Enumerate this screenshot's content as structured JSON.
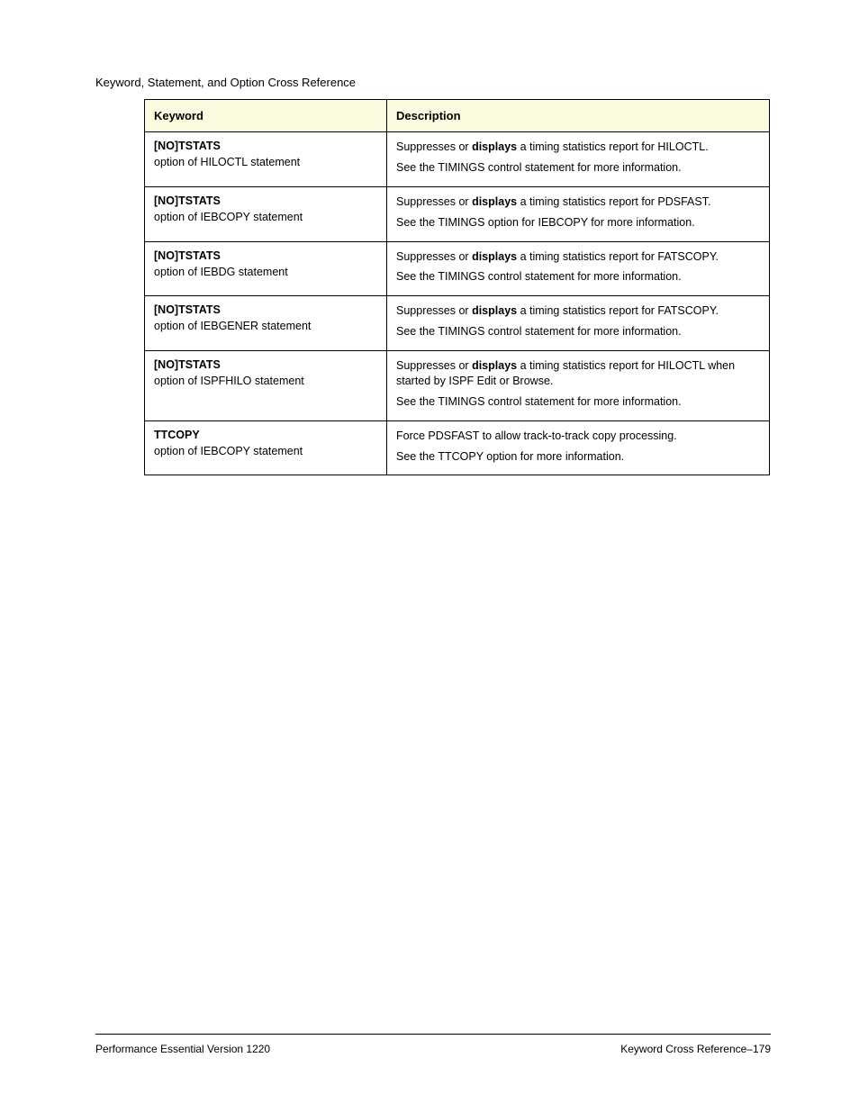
{
  "page_header": "Keyword, Statement, and Option Cross Reference",
  "table": {
    "header": {
      "col1": "Keyword",
      "col2": "Description"
    },
    "rows": [
      {
        "name": "[NO]TSTATS",
        "option_of": "HILOCTL statement",
        "desc_lead": "Suppresses or ",
        "desc_bold": "displays",
        "desc_rest": " a timing statistics report for HILOCTL.",
        "see": "See the TIMINGS control statement for more information."
      },
      {
        "name": "[NO]TSTATS",
        "option_of": "IEBCOPY statement",
        "desc_lead": "Suppresses or ",
        "desc_bold": "displays",
        "desc_rest": " a timing statistics report for PDSFAST.",
        "see": "See the TIMINGS option for IEBCOPY for more information."
      },
      {
        "name": "[NO]TSTATS",
        "option_of": "IEBDG statement",
        "desc_lead": "Suppresses or ",
        "desc_bold": "displays",
        "desc_rest": " a timing statistics report for FATSCOPY.",
        "see": "See the TIMINGS control statement for more information."
      },
      {
        "name": "[NO]TSTATS",
        "option_of": "IEBGENER statement",
        "desc_lead": "Suppresses or ",
        "desc_bold": "displays",
        "desc_rest": " a timing statistics report for FATSCOPY.",
        "see": "See the TIMINGS control statement for more information."
      },
      {
        "name": "[NO]TSTATS",
        "option_of": "ISPFHILO statement",
        "desc_lead": "Suppresses or ",
        "desc_bold": "displays",
        "desc_rest": " a timing statistics report for HILOCTL when started by ISPF Edit or Browse.",
        "see": "See the TIMINGS control statement for more information."
      },
      {
        "name": "TTCOPY",
        "option_of": "IEBCOPY statement",
        "desc_lead": "",
        "desc_bold": "",
        "desc_rest": "Force PDSFAST to allow track-to-track copy processing.",
        "see": "See the TTCOPY option for more information."
      }
    ]
  },
  "footer": {
    "left": "________________________________________________________________________________",
    "product": "Performance Essential    Version 1220",
    "page_label": "Keyword Cross Reference–179"
  }
}
